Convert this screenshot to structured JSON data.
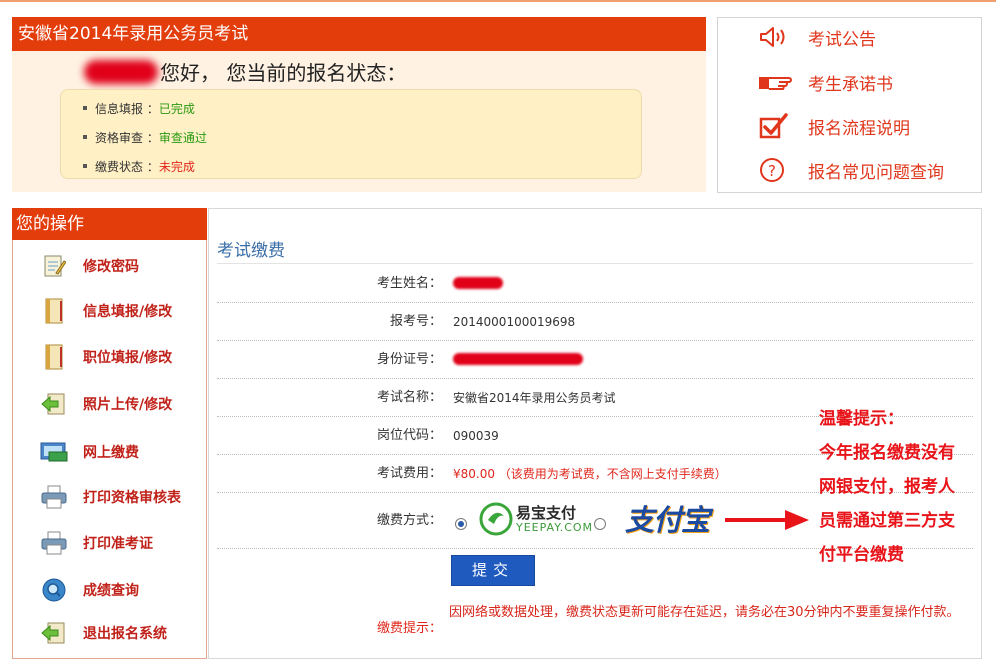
{
  "status_panel": {
    "title": "安徽省2014年录用公务员考试",
    "greeting": "您好， 您当前的报名状态：",
    "items": [
      {
        "label": "信息填报 ：",
        "value": "已完成",
        "state": "done"
      },
      {
        "label": "资格审查 ：",
        "value": "审查通过",
        "state": "done"
      },
      {
        "label": "缴费状态 ：",
        "value": "未完成",
        "state": "pending"
      }
    ]
  },
  "quick_links": [
    {
      "label": "考试公告",
      "icon": "speaker-icon"
    },
    {
      "label": "考生承诺书",
      "icon": "pointing-hand-icon"
    },
    {
      "label": "报名流程说明",
      "icon": "checkbox-icon"
    },
    {
      "label": "报名常见问题查询",
      "icon": "question-icon"
    }
  ],
  "sidebar": {
    "title": "您的操作",
    "items": [
      {
        "label": "修改密码",
        "icon": "notepad-icon"
      },
      {
        "label": "信息填报/修改",
        "icon": "book-icon"
      },
      {
        "label": "职位填报/修改",
        "icon": "book-icon"
      },
      {
        "label": "照片上传/修改",
        "icon": "upload-icon"
      },
      {
        "label": "网上缴费",
        "icon": "payment-icon"
      },
      {
        "label": "打印资格审核表",
        "icon": "printer-icon"
      },
      {
        "label": "打印准考证",
        "icon": "printer-icon"
      },
      {
        "label": "成绩查询",
        "icon": "search-icon"
      },
      {
        "label": "退出报名系统",
        "icon": "exit-icon"
      }
    ]
  },
  "main": {
    "title": "考试缴费",
    "fields": [
      {
        "label": "考生姓名：",
        "value": "",
        "redacted": true
      },
      {
        "label": "报考号：",
        "value": "2014000100019698"
      },
      {
        "label": "身份证号：",
        "value": "",
        "redacted": true
      },
      {
        "label": "考试名称：",
        "value": "安徽省2014年录用公务员考试"
      },
      {
        "label": "岗位代码：",
        "value": "090039"
      },
      {
        "label": "考试费用：",
        "value": "¥80.00  （该费用为考试费，不含网上支付手续费）"
      },
      {
        "label": "缴费方式：",
        "value": ""
      }
    ],
    "payment_options": [
      {
        "name": "易宝支付",
        "sub": "YEEPAY.COM",
        "selected": true
      },
      {
        "name": "支付宝",
        "selected": false
      }
    ],
    "submit_label": "提交",
    "tip_label": "缴费提示：",
    "tip_text": "因网络或数据处理，缴费状态更新可能存在延迟，请务必在30分钟内不要重复操作付款。"
  },
  "warm_tip": {
    "title": "温馨提示：",
    "lines": [
      "今年报名缴费没有",
      "网银支付，报考人",
      "员需通过第三方支",
      "付平台缴费"
    ]
  },
  "colors": {
    "header_bg": "#e43d0c",
    "accent_red": "#e0261b",
    "success_green": "#2a9a12",
    "link_blue": "#3a6ea8",
    "button_blue": "#1f5bbf"
  }
}
